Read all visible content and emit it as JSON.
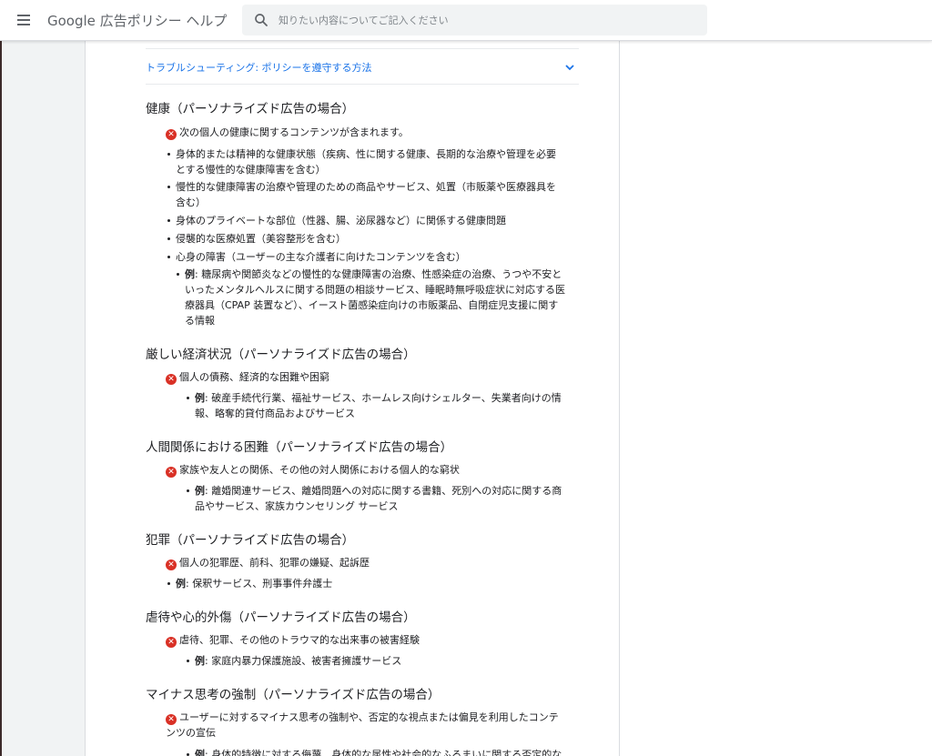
{
  "header": {
    "title": "Google 広告ポリシー ヘルプ",
    "search_placeholder": "知りたい内容についてご記入ください"
  },
  "trouble": {
    "label": "トラブルシューティング: ポリシーを遵守する方法"
  },
  "sections": {
    "health": {
      "heading": "健康（パーソナライズド広告の場合）",
      "prohibited": "次の個人の健康に関するコンテンツが含まれます。",
      "items": [
        "身体的または精神的な健康状態（疾病、性に関する健康、長期的な治療や管理を必要",
        "とする慢性的な健康障害を含む）",
        "慢性的な健康障害の治療や管理のための商品やサービス、処置（市販薬や医療器具を",
        "含む）",
        "身体のプライベートな部位（性器、腸、泌尿器など）に関係する健康問題",
        "侵襲的な医療処置（美容整形を含む）",
        "心身の障害（ユーザーの主な介護者に向けたコンテンツを含む）"
      ],
      "example_label": "例",
      "example_lines": [
        ": 糖尿病や関節炎などの慢性的な健康障害の治療、性感染症の治療、うつや不安と",
        "いったメンタルヘルスに関する問題の相談サービス、睡眠時無呼吸症状に対応する医",
        "療器具（CPAP 装置など）、イースト菌感染症向けの市販薬品、自閉症児支援に関す",
        "る情報"
      ]
    },
    "finance": {
      "heading": "厳しい経済状況（パーソナライズド広告の場合）",
      "prohibited": "個人の債務、経済的な困難や困窮",
      "example_label": "例",
      "example_lines": [
        ": 破産手続代行業、福祉サービス、ホームレス向けシェルター、失業者向けの情",
        "報、略奪的貸付商品およびサービス"
      ]
    },
    "relationships": {
      "heading": "人間関係における困難（パーソナライズド広告の場合）",
      "prohibited": "家族や友人との関係、その他の対人関係における個人的な窮状",
      "example_label": "例",
      "example_lines": [
        ": 離婚関連サービス、離婚問題への対応に関する書籍、死別への対応に関する商",
        "品やサービス、家族カウンセリング サービス"
      ]
    },
    "crime": {
      "heading": "犯罪（パーソナライズド広告の場合）",
      "prohibited": "個人の犯罪歴、前科、犯罪の嫌疑、起訴歴",
      "example_label": "例",
      "example_lines": [
        ": 保釈サービス、刑事事件弁護士"
      ]
    },
    "abuse": {
      "heading": "虐待や心的外傷（パーソナライズド広告の場合）",
      "prohibited": "虐待、犯罪、その他のトラウマ的な出来事の被害経験",
      "example_label": "例",
      "example_lines": [
        ": 家庭内暴力保護施設、被害者擁護サービス"
      ]
    },
    "negative": {
      "heading": "マイナス思考の強制（パーソナライズド広告の場合）",
      "prohibited_lines": [
        "ユーザーに対するマイナス思考の強制や、否定的な視点または偏見を利用したコンテ",
        "ンツの宣伝"
      ],
      "example_label": "例",
      "example_lines": [
        ": 身体的特徴に対する侮蔑、身体的な属性や社会的なふるまいに関する否定的な"
      ]
    }
  },
  "colors": {
    "link": "#1a73e8",
    "prohibited_icon": "#d93025"
  }
}
